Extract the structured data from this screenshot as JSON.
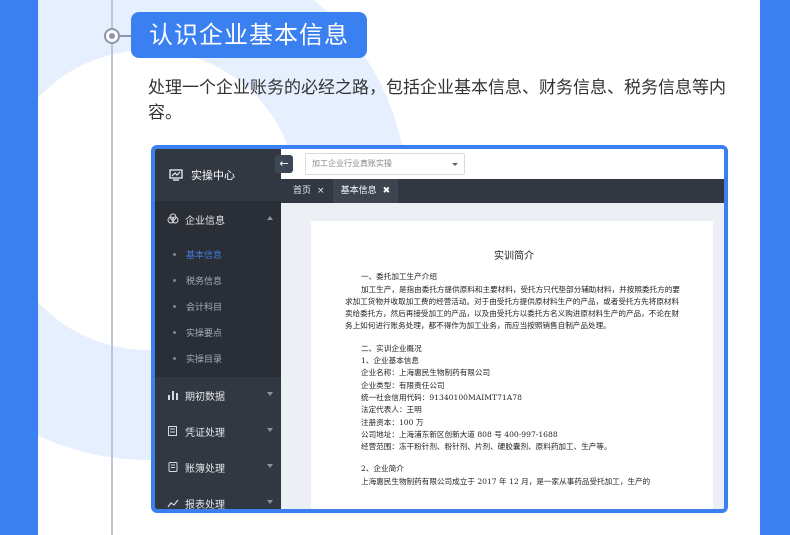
{
  "section": {
    "title": "认识企业基本信息",
    "intro": "处理一个企业账务的必经之路，包括企业基本信息、财务信息、税务信息等内容。",
    "accent_color": "#3a80f0"
  },
  "app": {
    "brand": "实操中心",
    "brand_icon": "monitor-chart-icon",
    "collapse_icon": "←",
    "company_select": {
      "value": "加工企业行业真账实操"
    },
    "sidebar": {
      "groups": [
        {
          "label": "企业信息",
          "icon": "building-icon",
          "expanded": true
        },
        {
          "label": "期初数据",
          "icon": "bar-chart-icon"
        },
        {
          "label": "凭证处理",
          "icon": "voucher-icon"
        },
        {
          "label": "账簿处理",
          "icon": "ledger-icon"
        },
        {
          "label": "报表处理",
          "icon": "report-icon"
        }
      ],
      "sub_items": [
        "基本信息",
        "税务信息",
        "会计科目",
        "实操要点",
        "实操目录"
      ]
    },
    "tabs": [
      {
        "label": "首页",
        "close": "×"
      },
      {
        "label": "基本信息",
        "close": "✖"
      }
    ],
    "document": {
      "title": "实训简介",
      "lines": {
        "s1_heading": "一、委托加工生产介绍",
        "s1_p1": "加工生产，是指由委托方提供原料和主要材料，受托方只代垫部分辅助材料，并按照委托方的要求加工货物并收取加工费的经营活动。对于由受托方提供原材料生产的产品，或者受托方先将原材料卖给委托方，然后再接受加工的产品，以及由受托方以委托方名义购进原材料生产的产品，不论在财务上如何进行账务处理，都不得作为加工业务，而应当按照销售自制产品处理。",
        "s2_heading": "二、实训企业概况",
        "s2_sub1": "1、企业基本信息",
        "name": "企业名称：上海惠民生物制药有限公司",
        "type": "企业类型：有限责任公司",
        "credit": "统一社会信用代码：91340100MAIMT71A78",
        "rep": "法定代表人：王明",
        "capital": "注册资本：100 万",
        "address": "公司地址：上海浦东新区创新大道 808 号 400-997-1688",
        "scope": "经营范围：冻干粉针剂、粉针剂、片剂、硬胶囊剂、原料药加工、生产等。",
        "s2_sub2": "2、企业简介",
        "intro_start": "上海惠民生物制药有限公司成立于 2017 年 12 月，是一家从事药品受托加工，生产的"
      }
    }
  }
}
